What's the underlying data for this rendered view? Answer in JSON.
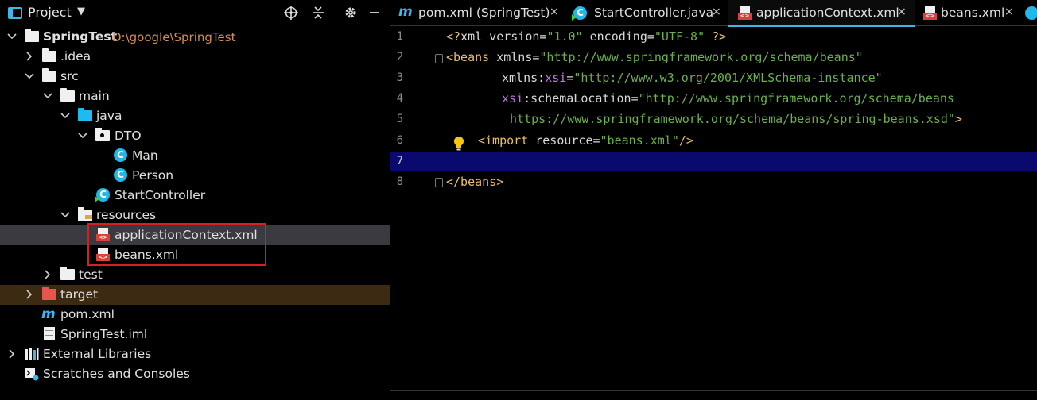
{
  "project_panel": {
    "title": "Project",
    "tree": [
      {
        "label": "SpringTest",
        "path": "D:\\google\\SpringTest"
      },
      {
        "label": ".idea"
      },
      {
        "label": "src"
      },
      {
        "label": "main"
      },
      {
        "label": "java"
      },
      {
        "label": "DTO"
      },
      {
        "label": "Man"
      },
      {
        "label": "Person"
      },
      {
        "label": "StartController"
      },
      {
        "label": "resources"
      },
      {
        "label": "applicationContext.xml"
      },
      {
        "label": "beans.xml"
      },
      {
        "label": "test"
      },
      {
        "label": "target"
      },
      {
        "label": "pom.xml"
      },
      {
        "label": "SpringTest.iml"
      },
      {
        "label": "External Libraries"
      },
      {
        "label": "Scratches and Consoles"
      }
    ],
    "xml_badge": "<>"
  },
  "editor": {
    "tabs": [
      {
        "icon_text": "m",
        "label": "pom.xml (SpringTest)",
        "close": "×"
      },
      {
        "icon_text": "C",
        "label": "StartController.java",
        "close": "×"
      },
      {
        "label": "applicationContext.xml",
        "close": "×"
      },
      {
        "label": "beans.xml",
        "close": "×"
      }
    ],
    "line_numbers": [
      "1",
      "2",
      "3",
      "4",
      "5",
      "6",
      "7",
      "8"
    ],
    "code": {
      "l1": {
        "a": "<?",
        "b": "xml version",
        "c": "=",
        "d": "\"1.0\"",
        "e": " encoding",
        "f": "=",
        "g": "\"UTF-8\"",
        "h": " ?>"
      },
      "l2": {
        "a": "<beans",
        "b": " xmlns",
        "c": "=",
        "d": "\"http://www.springframework.org/schema/beans\""
      },
      "l3": {
        "a": "xmlns",
        "b": ":",
        "c": "xsi",
        "d": "=",
        "e": "\"http://www.w3.org/2001/XMLSchema-instance\""
      },
      "l4": {
        "a": "xsi",
        "b": ":schemaLocation",
        "c": "=",
        "d": "\"http://www.springframework.org/schema/beans"
      },
      "l5": {
        "a": "https://www.springframework.org/schema/beans/spring-beans.xsd\"",
        "b": ">"
      },
      "l6": {
        "a": "<import",
        "b": " resource",
        "c": "=",
        "d": "\"beans.xml\"",
        "e": "/>"
      },
      "l8": {
        "a": "</beans>"
      }
    }
  }
}
